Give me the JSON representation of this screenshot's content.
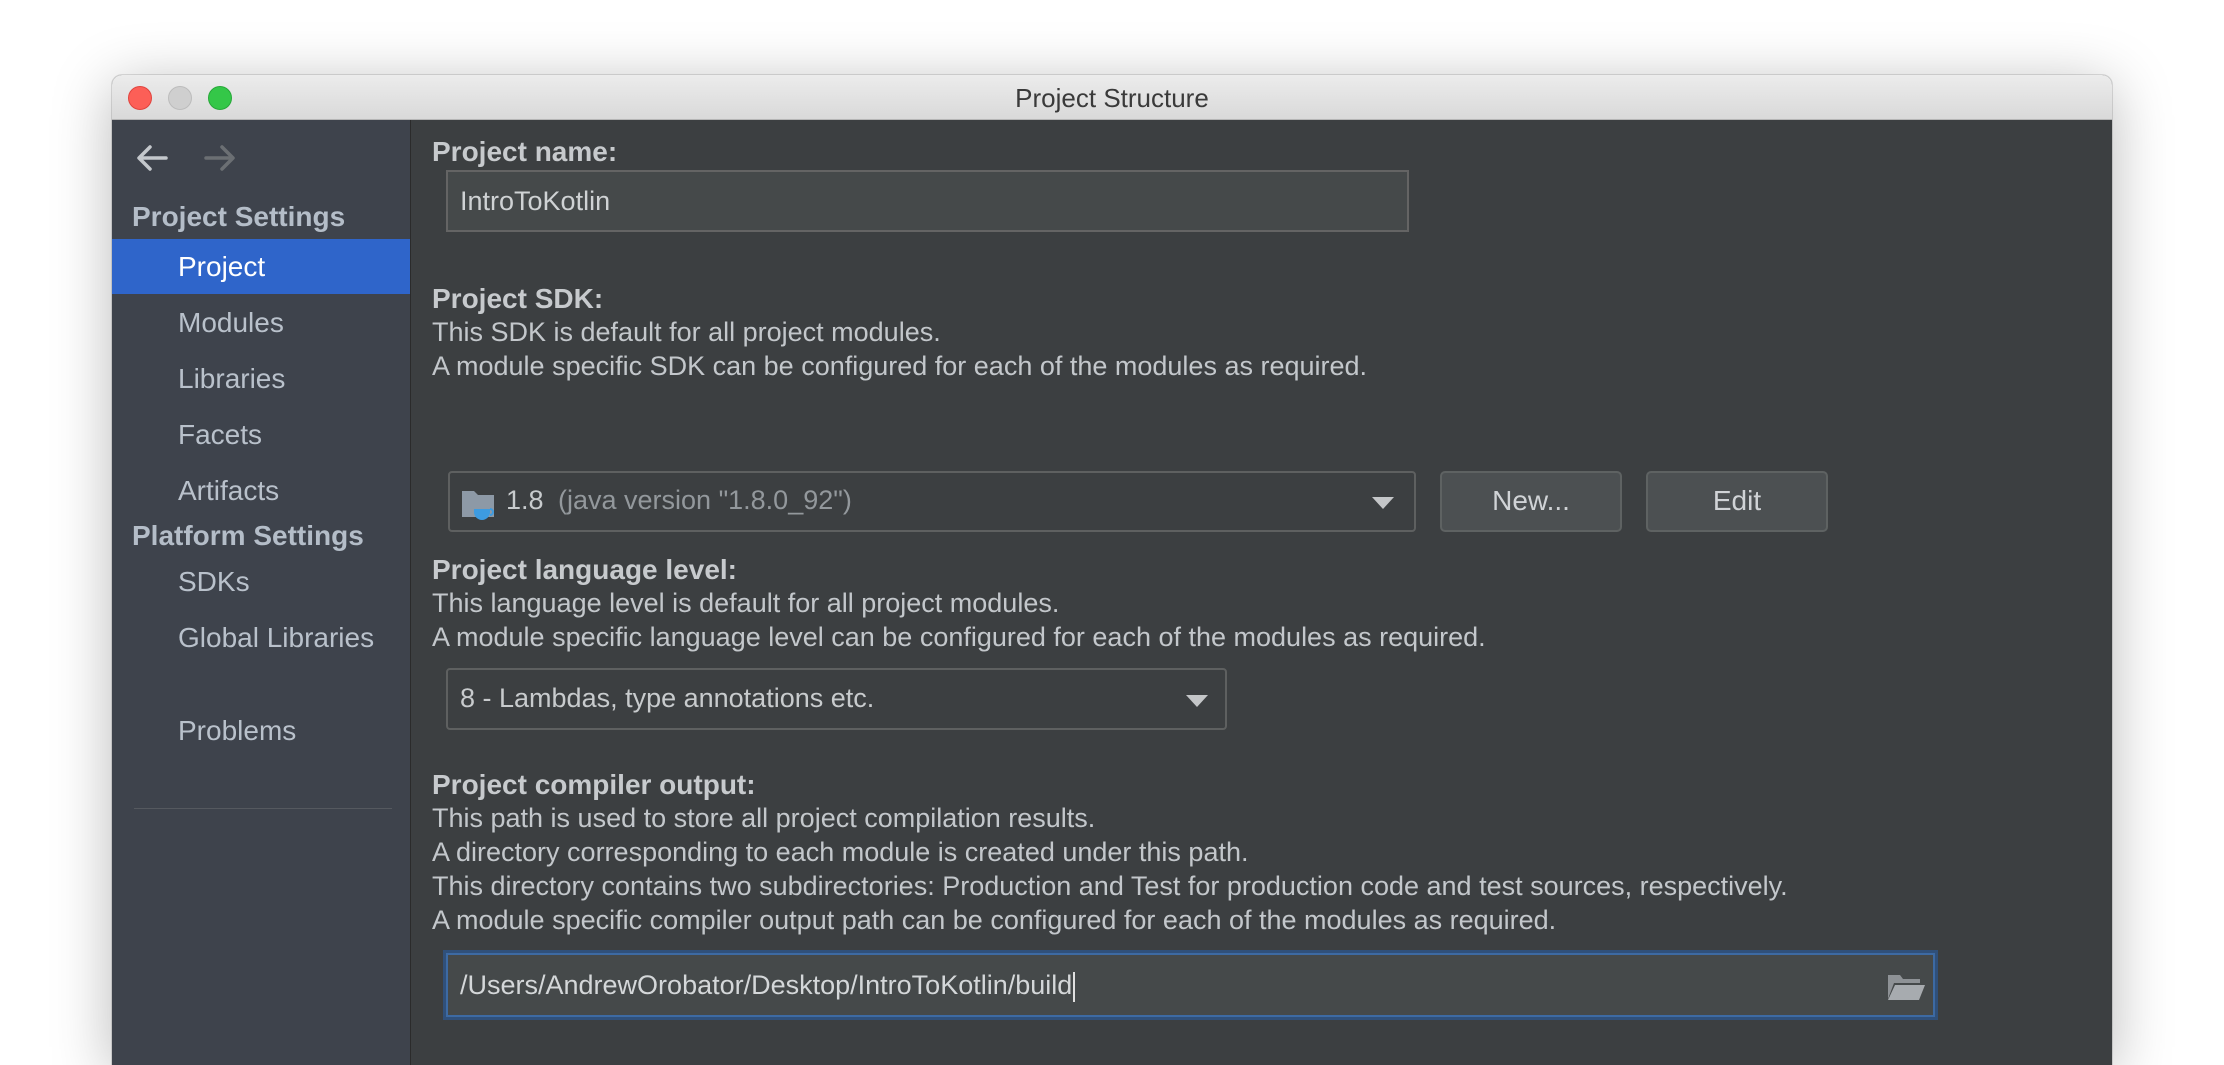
{
  "window": {
    "title": "Project Structure"
  },
  "sidebar": {
    "project_settings_heading": "Project Settings",
    "platform_settings_heading": "Platform Settings",
    "items": [
      {
        "label": "Project",
        "selected": true
      },
      {
        "label": "Modules",
        "selected": false
      },
      {
        "label": "Libraries",
        "selected": false
      },
      {
        "label": "Facets",
        "selected": false
      },
      {
        "label": "Artifacts",
        "selected": false
      },
      {
        "label": "SDKs",
        "selected": false
      },
      {
        "label": "Global Libraries",
        "selected": false
      },
      {
        "label": "Problems",
        "selected": false
      }
    ]
  },
  "main": {
    "project_name_label": "Project name:",
    "project_name_value": "IntroToKotlin",
    "sdk_label": "Project SDK:",
    "sdk_desc_1": "This SDK is default for all project modules.",
    "sdk_desc_2": "A module specific SDK can be configured for each of the modules as required.",
    "sdk_version": "1.8",
    "sdk_detail": "(java version \"1.8.0_92\")",
    "new_button": "New...",
    "edit_button": "Edit",
    "lang_label": "Project language level:",
    "lang_desc_1": "This language level is default for all project modules.",
    "lang_desc_2": "A module specific language level can be configured for each of the modules as required.",
    "lang_value": "8 - Lambdas, type annotations etc.",
    "output_label": "Project compiler output:",
    "output_desc_1": "This path is used to store all project compilation results.",
    "output_desc_2": "A directory corresponding to each module is created under this path.",
    "output_desc_3": "This directory contains two subdirectories: Production and Test for production code and test sources, respectively.",
    "output_desc_4": "A module specific compiler output path can be configured for each of the modules as required.",
    "output_path": "/Users/AndrewOrobator/Desktop/IntroToKotlin/build"
  },
  "icons": [
    "close-button",
    "minimize-button",
    "zoom-button",
    "back-arrow-icon",
    "forward-arrow-icon",
    "sdk-folder-icon",
    "chevron-down-icon",
    "folder-browse-icon"
  ],
  "colors": {
    "selection": "#2f65ca",
    "sidebar_bg": "#3e434c",
    "panel_bg": "#3c3f41",
    "focus_border": "#3d6aa3"
  }
}
